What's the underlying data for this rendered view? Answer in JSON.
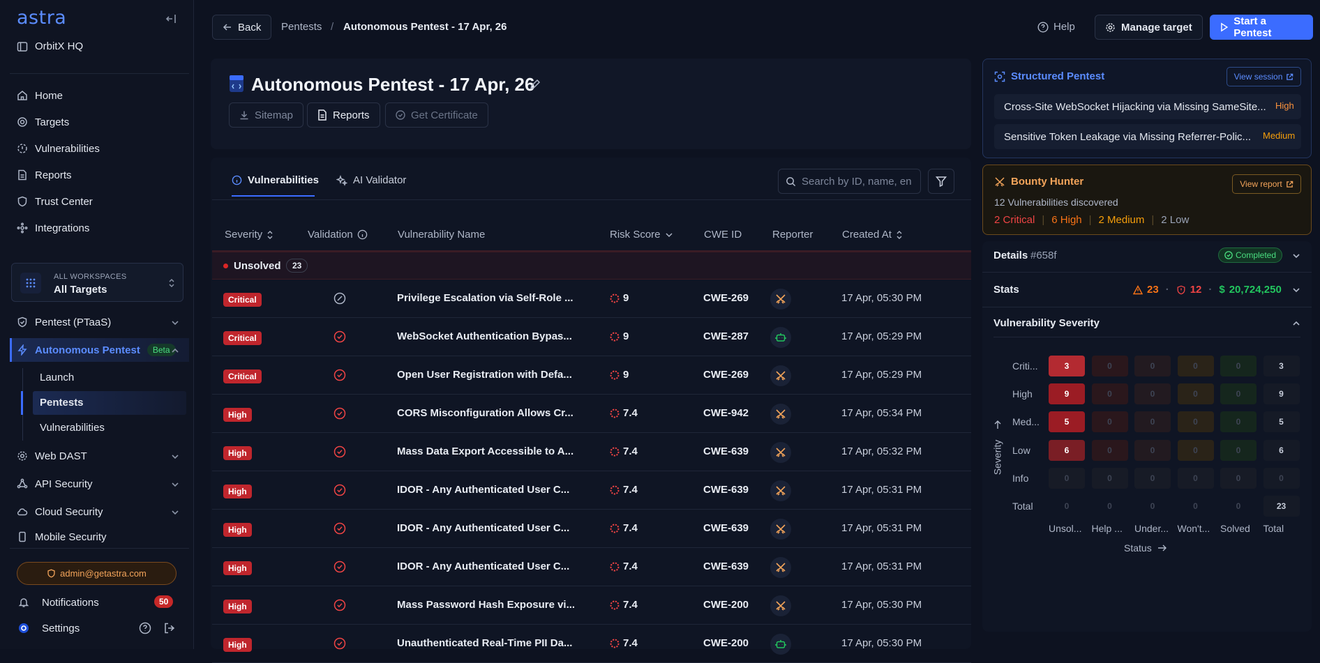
{
  "sidebar": {
    "logo": "astra",
    "workspace_name": "OrbitX HQ",
    "nav": [
      {
        "label": "Home"
      },
      {
        "label": "Targets"
      },
      {
        "label": "Vulnerabilities"
      },
      {
        "label": "Reports"
      },
      {
        "label": "Trust Center"
      },
      {
        "label": "Integrations"
      }
    ],
    "ws_card": {
      "caption": "ALL WORKSPACES",
      "value": "All Targets"
    },
    "sections": {
      "pentest": "Pentest (PTaaS)",
      "autonomous": "Autonomous Pentest",
      "beta": "Beta",
      "sub": [
        "Launch",
        "Pentests",
        "Vulnerabilities"
      ],
      "web_dast": "Web DAST",
      "api_security": "API Security",
      "cloud_security": "Cloud Security",
      "mobile_security": "Mobile Security"
    },
    "user_email": "admin@getastra.com",
    "notifications_label": "Notifications",
    "notifications_count": "50",
    "settings_label": "Settings"
  },
  "topbar": {
    "back": "Back",
    "breadcrumb_parent": "Pentests",
    "breadcrumb_sep": "/",
    "breadcrumb_current": "Autonomous Pentest - 17 Apr, 26",
    "help": "Help",
    "manage_target": "Manage target",
    "start_pentest": "Start a Pentest"
  },
  "header": {
    "title": "Autonomous Pentest - 17 Apr, 26",
    "sitemap": "Sitemap",
    "reports": "Reports",
    "certificate": "Get Certificate"
  },
  "tabs": {
    "vulnerabilities": "Vulnerabilities",
    "ai_validator": "AI Validator",
    "search_placeholder": "Search by ID, name, en"
  },
  "table": {
    "columns": {
      "severity": "Severity",
      "validation": "Validation",
      "name": "Vulnerability Name",
      "risk": "Risk Score",
      "cwe": "CWE ID",
      "reporter": "Reporter",
      "created": "Created At"
    },
    "group_label": "Unsolved",
    "group_count": "23",
    "rows": [
      {
        "severity": "Critical",
        "validation": "skip",
        "name": "Privilege Escalation via Self-Role ...",
        "risk": "9",
        "cwe": "CWE-269",
        "reporter": "bounty",
        "created": "17 Apr, 05:30 PM"
      },
      {
        "severity": "Critical",
        "validation": "check",
        "name": "WebSocket Authentication Bypas...",
        "risk": "9",
        "cwe": "CWE-287",
        "reporter": "bot",
        "created": "17 Apr, 05:29 PM"
      },
      {
        "severity": "Critical",
        "validation": "check",
        "name": "Open User Registration with Defa...",
        "risk": "9",
        "cwe": "CWE-269",
        "reporter": "bounty",
        "created": "17 Apr, 05:29 PM"
      },
      {
        "severity": "High",
        "validation": "check",
        "name": "CORS Misconfiguration Allows Cr...",
        "risk": "7.4",
        "cwe": "CWE-942",
        "reporter": "bounty",
        "created": "17 Apr, 05:34 PM"
      },
      {
        "severity": "High",
        "validation": "check",
        "name": "Mass Data Export Accessible to A...",
        "risk": "7.4",
        "cwe": "CWE-639",
        "reporter": "bounty",
        "created": "17 Apr, 05:32 PM"
      },
      {
        "severity": "High",
        "validation": "check",
        "name": "IDOR - Any Authenticated User C...",
        "risk": "7.4",
        "cwe": "CWE-639",
        "reporter": "bounty",
        "created": "17 Apr, 05:31 PM"
      },
      {
        "severity": "High",
        "validation": "check",
        "name": "IDOR - Any Authenticated User C...",
        "risk": "7.4",
        "cwe": "CWE-639",
        "reporter": "bounty",
        "created": "17 Apr, 05:31 PM"
      },
      {
        "severity": "High",
        "validation": "check",
        "name": "IDOR - Any Authenticated User C...",
        "risk": "7.4",
        "cwe": "CWE-639",
        "reporter": "bounty",
        "created": "17 Apr, 05:31 PM"
      },
      {
        "severity": "High",
        "validation": "check",
        "name": "Mass Password Hash Exposure vi...",
        "risk": "7.4",
        "cwe": "CWE-200",
        "reporter": "bounty",
        "created": "17 Apr, 05:30 PM"
      },
      {
        "severity": "High",
        "validation": "check",
        "name": "Unauthenticated Real-Time PII Da...",
        "risk": "7.4",
        "cwe": "CWE-200",
        "reporter": "bot",
        "created": "17 Apr, 05:30 PM"
      }
    ]
  },
  "right_panel": {
    "structured": {
      "title": "Structured Pentest",
      "view_session": "View session",
      "items": [
        {
          "name": "Cross-Site WebSocket Hijacking via Missing SameSite...",
          "severity": "High"
        },
        {
          "name": "Sensitive Token Leakage via Missing Referrer-Polic...",
          "severity": "Medium"
        }
      ]
    },
    "bounty": {
      "title": "Bounty Hunter",
      "view_report": "View report",
      "discovered": "12 Vulnerabilities discovered",
      "critical": "2 Critical",
      "high": "6 High",
      "medium": "2 Medium",
      "low": "2 Low"
    },
    "details": {
      "label": "Details",
      "id": "#658f",
      "status": "Completed"
    },
    "stats": {
      "label": "Stats",
      "warnings": "23",
      "alerts": "12",
      "bounty": "20,724,250"
    },
    "severity_title": "Vulnerability Severity",
    "heatmap": {
      "y_axis": "Severity",
      "x_axis": "Status",
      "rows": [
        "Criti...",
        "High",
        "Med...",
        "Low",
        "Info",
        "Total"
      ],
      "cols": [
        "Unsol...",
        "Help ...",
        "Under...",
        "Won't...",
        "Solved",
        "Total"
      ],
      "values": [
        [
          "3",
          "0",
          "0",
          "0",
          "0",
          "3"
        ],
        [
          "9",
          "0",
          "0",
          "0",
          "0",
          "9"
        ],
        [
          "5",
          "0",
          "0",
          "0",
          "0",
          "5"
        ],
        [
          "6",
          "0",
          "0",
          "0",
          "0",
          "6"
        ],
        [
          "0",
          "0",
          "0",
          "0",
          "0",
          "0"
        ],
        [
          "0",
          "0",
          "0",
          "0",
          "0",
          "23"
        ]
      ]
    }
  },
  "colors": {
    "accent": "#3b6cff",
    "critical": "#c0262d",
    "success": "#22c55e",
    "warning": "#f59e0b"
  }
}
